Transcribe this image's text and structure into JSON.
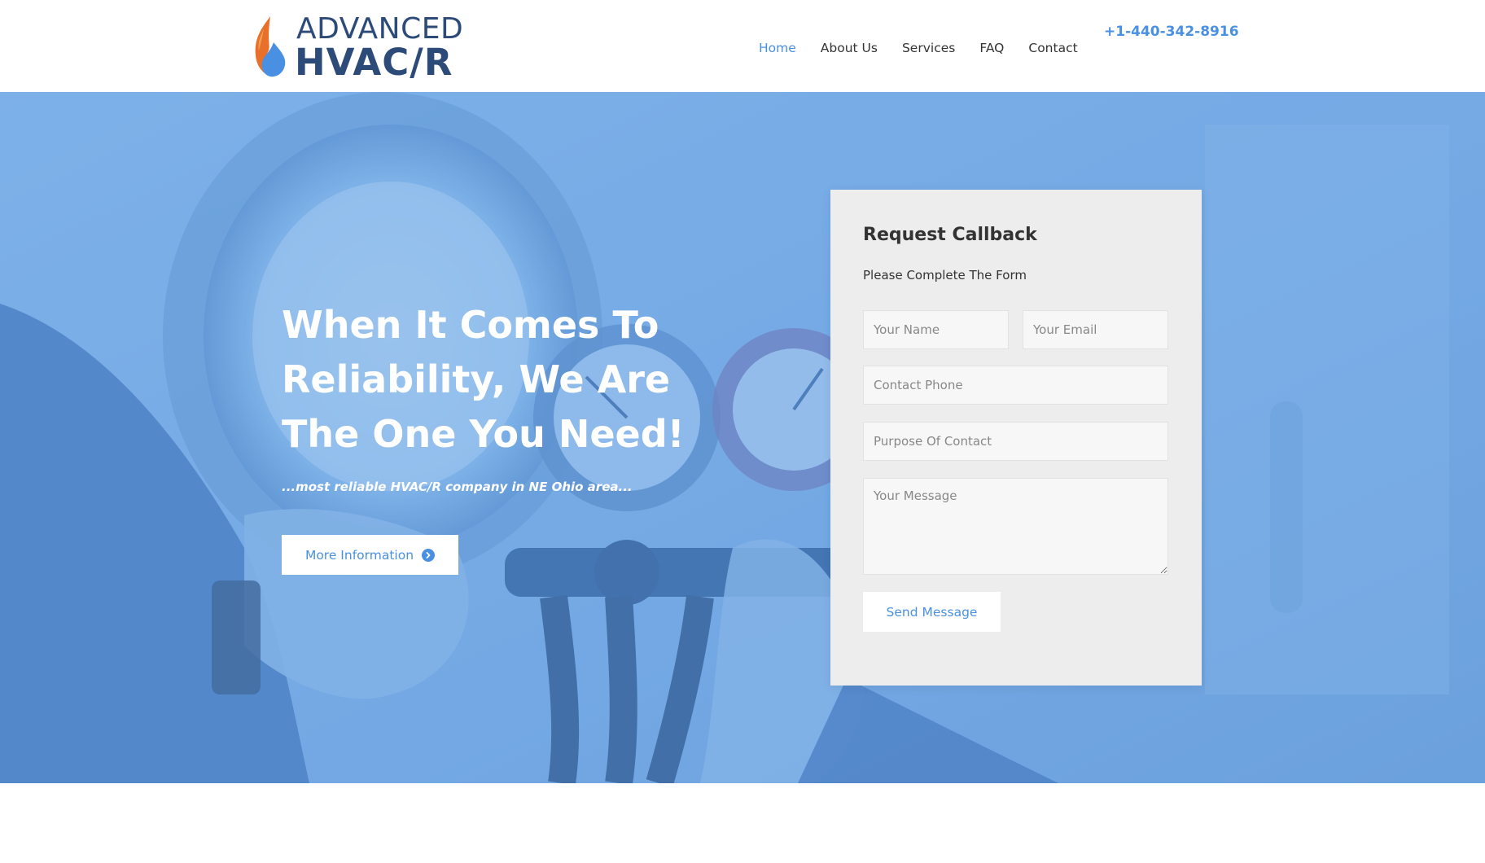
{
  "brand": {
    "line1": "ADVANCED",
    "line2": "HVAC/R",
    "flame_colors": [
      "#e8702a",
      "#4a90e2"
    ],
    "text_color": "#2d4b78"
  },
  "nav": {
    "items": [
      {
        "label": "Home",
        "active": true
      },
      {
        "label": "About Us",
        "active": false
      },
      {
        "label": "Services",
        "active": false
      },
      {
        "label": "FAQ",
        "active": false
      },
      {
        "label": "Contact",
        "active": false
      }
    ]
  },
  "header": {
    "phone": "+1-440-342-8916"
  },
  "hero": {
    "title": "When It Comes To Reliability, We Are The One You Need!",
    "subtitle": "...most reliable HVAC/R company in NE Ohio area...",
    "button_label": "More Information",
    "button_icon": "chevron-circle-right-icon"
  },
  "form": {
    "title": "Request Callback",
    "subtitle": "Please Complete The Form",
    "name_placeholder": "Your Name",
    "email_placeholder": "Your Email",
    "phone_placeholder": "Contact Phone",
    "purpose_placeholder": "Purpose Of Contact",
    "message_placeholder": "Your Message",
    "submit_label": "Send Message"
  },
  "colors": {
    "accent": "#4a90e2",
    "hero_tint": "#7fb0e6",
    "card_bg": "#ededee",
    "text": "#333333"
  }
}
